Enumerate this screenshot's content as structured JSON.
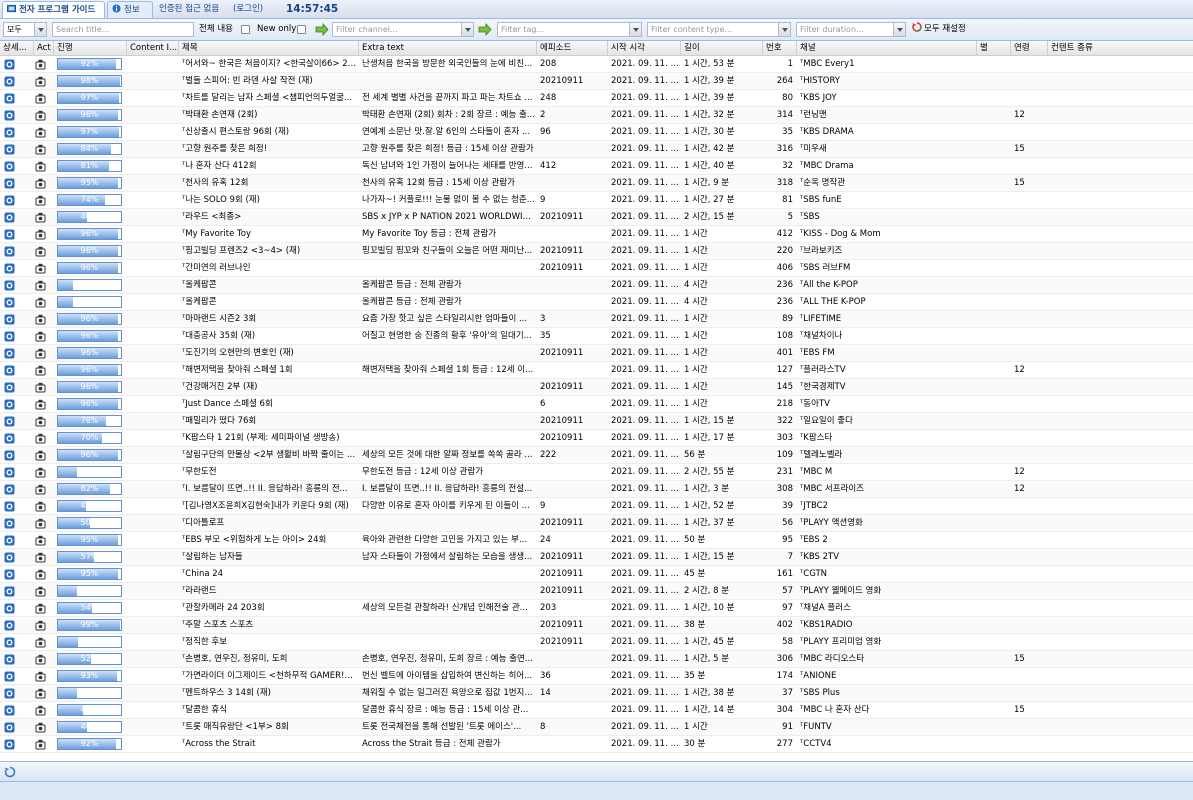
{
  "tabs": {
    "guide": "전자 프로그램 가이드",
    "info": "정보",
    "access": "인증된 접근 없음",
    "login": "(로그인)",
    "clock": "14:57:45"
  },
  "toolbar": {
    "scope_select": "모두",
    "search_placeholder": "Search title...",
    "full_content_label": "전체 내용",
    "new_only_label": "New only",
    "channel_placeholder": "Filter channel...",
    "tag_placeholder": "Filter tag...",
    "content_type_placeholder": "Filter content type...",
    "duration_placeholder": "Filter duration...",
    "reset_label": "모두 재설정"
  },
  "columns": {
    "details": "상세...",
    "actions": "Act",
    "progress": "진행",
    "content_icon": "Content I...",
    "title": "제목",
    "extra": "Extra text",
    "episode": "에피소드",
    "start": "시작 시각",
    "length": "길이",
    "number": "번호",
    "channel": "채널",
    "star": "별",
    "age": "연령",
    "content_type": "컨텐트 종류"
  },
  "rows": [
    {
      "p": 92,
      "pt": "92%",
      "t": "ᵀ어서와~ 한국은 처음이지? <한국살이66> 20...",
      "e": "난생처음 한국을 방문한 외국인들의 눈에 비친...",
      "ep": "208",
      "s": "2021. 09. 11. (...",
      "l": "1 시간, 53 분",
      "n": "1",
      "ch": "ᵀMBC Every1",
      "a": ""
    },
    {
      "p": 98,
      "pt": "98%",
      "t": "ᵀ벌들 스피어: 빈 라덴 사살 작전 (재)",
      "e": "",
      "ep": "20210911",
      "s": "2021. 09. 11. (...",
      "l": "1 시간, 39 분",
      "n": "264",
      "ch": "ᵀHISTORY",
      "a": ""
    },
    {
      "p": 97,
      "pt": "97%",
      "t": "ᵀ차트를 달리는 남자 스페셜 <챔피언의두얼굴...",
      "e": "전 세계 별별 사건을 끝까지 파고 파는 차트쇼 ...",
      "ep": "248",
      "s": "2021. 09. 11. (...",
      "l": "1 시간, 39 분",
      "n": "80",
      "ch": "ᵀKBS JOY",
      "a": ""
    },
    {
      "p": 96,
      "pt": "96%",
      "t": "ᵀ박태환 손연재 (2회)",
      "e": "박태환 손연재 (2회) 회차 : 2회 장르 : 예능 출...",
      "ep": "2",
      "s": "2021. 09. 11. (...",
      "l": "1 시간, 32 분",
      "n": "314",
      "ch": "ᵀ런닝맨",
      "a": "12"
    },
    {
      "p": 97,
      "pt": "97%",
      "t": "ᵀ신상출시 편스토랑 96회 (재)",
      "e": "연예계 소문난 맛.잘.알 6인의 스타들이 혼자 ...",
      "ep": "96",
      "s": "2021. 09. 11. (...",
      "l": "1 시간, 30 분",
      "n": "35",
      "ch": "ᵀKBS DRAMA",
      "a": ""
    },
    {
      "p": 84,
      "pt": "84%",
      "t": "ᵀ고향 원주를 찾은 희정!",
      "e": "고향 원주를 찾은 희정! 등급 : 15세 이상 관람가",
      "ep": "",
      "s": "2021. 09. 11. (...",
      "l": "1 시간, 42 분",
      "n": "316",
      "ch": "ᵀ미우새",
      "a": "15"
    },
    {
      "p": 81,
      "pt": "81%",
      "t": "ᵀ나 혼자 산다 412회",
      "e": "독신 남녀와 1인 가정이 늘어나는 세태를 반영...",
      "ep": "412",
      "s": "2021. 09. 11. (...",
      "l": "1 시간, 40 분",
      "n": "32",
      "ch": "ᵀMBC Drama",
      "a": ""
    },
    {
      "p": 95,
      "pt": "95%",
      "t": "ᵀ천사의 유혹 12회",
      "e": "천사의 유혹 12회 등급 : 15세 이상 관람가",
      "ep": "",
      "s": "2021. 09. 11. (...",
      "l": "1 시간, 9 분",
      "n": "318",
      "ch": "ᵀ순옥 명작관",
      "a": "15"
    },
    {
      "p": 74,
      "pt": "74%",
      "t": "ᵀ나는 SOLO 9회 (재)",
      "e": "나가자~! 커플로!!! 눈물 없이 볼 수 없는 청춘...",
      "ep": "9",
      "s": "2021. 09. 11. (...",
      "l": "1 시간, 27 분",
      "n": "81",
      "ch": "ᵀSBS funE",
      "a": ""
    },
    {
      "p": 46,
      "pt": "46%",
      "t": "ᵀ라우드 <최종>",
      "e": "SBS x JYP x P NATION 2021 WORLDWID...",
      "ep": "20210911",
      "s": "2021. 09. 11. (...",
      "l": "2 시간, 15 분",
      "n": "5",
      "ch": "ᵀSBS",
      "a": ""
    },
    {
      "p": 96,
      "pt": "96%",
      "t": "ᵀMy Favorite Toy",
      "e": "My Favorite Toy 등급 : 전체 관람가",
      "ep": "",
      "s": "2021. 09. 11. (...",
      "l": "1 시간",
      "n": "412",
      "ch": "ᵀKISS - Dog & Mom",
      "a": ""
    },
    {
      "p": 96,
      "pt": "96%",
      "t": "ᵀ핑고빌딩 프렌즈2 <3~4> (재)",
      "e": "핑꼬빌딩 핑꼬와 친구들이 오늘은 어떤 재미난...",
      "ep": "20210911",
      "s": "2021. 09. 11. (...",
      "l": "1 시간",
      "n": "220",
      "ch": "ᵀ브라보키즈",
      "a": ""
    },
    {
      "p": 96,
      "pt": "96%",
      "t": "ᵀ간미연의 러브나인",
      "e": "",
      "ep": "20210911",
      "s": "2021. 09. 11. (...",
      "l": "1 시간",
      "n": "406",
      "ch": "ᵀSBS 러브FM",
      "a": ""
    },
    {
      "p": 24,
      "pt": "24%",
      "t": "ᵀ올케팝콘",
      "e": "올케팝콘 등급 : 전체 관람가",
      "ep": "",
      "s": "2021. 09. 11. (...",
      "l": "4 시간",
      "n": "236",
      "ch": "ᵀAll the K-POP",
      "a": ""
    },
    {
      "p": 24,
      "pt": "24%",
      "t": "ᵀ올케팝콘",
      "e": "올케팝콘 등급 : 전체 관람가",
      "ep": "",
      "s": "2021. 09. 11. (...",
      "l": "4 시간",
      "n": "236",
      "ch": "ᵀALL THE K-POP",
      "a": ""
    },
    {
      "p": 96,
      "pt": "96%",
      "t": "ᵀ마마랜드 시즌2 3회",
      "e": "요즘 가장 핫고 싶은 스타일리시한 엄마들이 ...",
      "ep": "3",
      "s": "2021. 09. 11. (...",
      "l": "1 시간",
      "n": "89",
      "ch": "ᵀLIFETIME",
      "a": ""
    },
    {
      "p": 96,
      "pt": "96%",
      "t": "ᵀ대충공사 35회 (재)",
      "e": "어질고 현명한 숭 진종의 황후 '유아'의 일대기...",
      "ep": "35",
      "s": "2021. 09. 11. (...",
      "l": "1 시간",
      "n": "108",
      "ch": "ᵀ채널차이나",
      "a": ""
    },
    {
      "p": 96,
      "pt": "96%",
      "t": "ᵀ도진기의 오현만의 변호인 (재)",
      "e": "",
      "ep": "20210911",
      "s": "2021. 09. 11. (...",
      "l": "1 시간",
      "n": "401",
      "ch": "ᵀEBS FM",
      "a": ""
    },
    {
      "p": 96,
      "pt": "96%",
      "t": "ᵀ해변저택을 찾아줘 스페셜 1회",
      "e": "해변저택을 찾아줘 스페셜 1회 등급 : 12세 이...",
      "ep": "",
      "s": "2021. 09. 11. (...",
      "l": "1 시간",
      "n": "127",
      "ch": "ᵀ플러라스TV",
      "a": "12"
    },
    {
      "p": 96,
      "pt": "96%",
      "t": "ᵀ건강매거진 2부 (재)",
      "e": "",
      "ep": "20210911",
      "s": "2021. 09. 11. (...",
      "l": "1 시간",
      "n": "145",
      "ch": "ᵀ한국경제TV",
      "a": ""
    },
    {
      "p": 96,
      "pt": "96%",
      "t": "ᵀJust Dance 스페셜 6회",
      "e": "",
      "ep": "6",
      "s": "2021. 09. 11. (...",
      "l": "1 시간",
      "n": "218",
      "ch": "ᵀ동아TV",
      "a": ""
    },
    {
      "p": 76,
      "pt": "76%",
      "t": "ᵀ패밀리가 떴다 76회",
      "e": "",
      "ep": "20210911",
      "s": "2021. 09. 11. (...",
      "l": "1 시간, 15 분",
      "n": "322",
      "ch": "ᵀ일요일이 좋다",
      "a": ""
    },
    {
      "p": 70,
      "pt": "70%",
      "t": "ᵀK팝스타 1 21회 (부제: 세미파이널 생방송)",
      "e": "",
      "ep": "20210911",
      "s": "2021. 09. 11. (...",
      "l": "1 시간, 17 분",
      "n": "303",
      "ch": "ᵀK팝스타",
      "a": ""
    },
    {
      "p": 96,
      "pt": "96%",
      "t": "ᵀ살림구단의 만물상 <2부 생활비 바짝 줄이는 ...",
      "e": "세상의 모든 것에 대한 알짜 정보를 쏙쏙 골라 ...",
      "ep": "222",
      "s": "2021. 09. 11. (...",
      "l": "56 분",
      "n": "109",
      "ch": "ᵀ텔레노벨라",
      "a": ""
    },
    {
      "p": 30,
      "pt": "30%",
      "t": "ᵀ무한도전",
      "e": "무한도전 등급 : 12세 이상 관람가",
      "ep": "",
      "s": "2021. 09. 11. (...",
      "l": "2 시간, 55 분",
      "n": "231",
      "ch": "ᵀMBC M",
      "a": "12"
    },
    {
      "p": 82,
      "pt": "82%",
      "t": "ᵀI. 보름달이 뜨면..!! II. 응답하라! 흥릉의 전...",
      "e": "I. 보름달이 뜨면..!! II. 응답하라! 흥릉의 전설...",
      "ep": "",
      "s": "2021. 09. 11. (...",
      "l": "1 시간, 3 분",
      "n": "308",
      "ch": "ᵀMBC 서프라이즈",
      "a": "12"
    },
    {
      "p": 44,
      "pt": "44%",
      "t": "ᵀ[김나영X조윤희X김현숙]내가 키운다 9회 (재)",
      "e": "다양한 이유로 혼자 아이를 키우게 된 이들이 ...",
      "ep": "9",
      "s": "2021. 09. 11. (...",
      "l": "1 시간, 52 분",
      "n": "39",
      "ch": "ᵀJTBC2",
      "a": ""
    },
    {
      "p": 50,
      "pt": "50%",
      "t": "ᵀ디아틀로프",
      "e": "",
      "ep": "20210911",
      "s": "2021. 09. 11. (...",
      "l": "1 시간, 37 분",
      "n": "56",
      "ch": "ᵀPLAYY 액션영화",
      "a": ""
    },
    {
      "p": 95,
      "pt": "95%",
      "t": "ᵀEBS 부모 <위험하게 노는 아이> 24회",
      "e": "육아와 관련한 다양한 고민을 가지고 있는 부...",
      "ep": "24",
      "s": "2021. 09. 11. (...",
      "l": "50 분",
      "n": "95",
      "ch": "ᵀEBS 2",
      "a": ""
    },
    {
      "p": 57,
      "pt": "57%",
      "t": "ᵀ살림하는 남자들",
      "e": "남자 스타들이 가정에서 살림하는 모습을 생생...",
      "ep": "20210911",
      "s": "2021. 09. 11. (...",
      "l": "1 시간, 15 분",
      "n": "7",
      "ch": "ᵀKBS 2TV",
      "a": ""
    },
    {
      "p": 95,
      "pt": "95%",
      "t": "ᵀChina 24",
      "e": "",
      "ep": "20210911",
      "s": "2021. 09. 11. (...",
      "l": "45 분",
      "n": "161",
      "ch": "ᵀCGTN",
      "a": ""
    },
    {
      "p": 30,
      "pt": "30%",
      "t": "ᵀ라라랜드",
      "e": "",
      "ep": "20210911",
      "s": "2021. 09. 11. (...",
      "l": "2 시간, 8 분",
      "n": "57",
      "ch": "ᵀPLAYY 웰메이드 영화",
      "a": ""
    },
    {
      "p": 54,
      "pt": "54%",
      "t": "ᵀ관찰카메라 24 203회",
      "e": "세상의 모든걸 관찰하라! 신개념 인해전술 관...",
      "ep": "203",
      "s": "2021. 09. 11. (...",
      "l": "1 시간, 10 분",
      "n": "97",
      "ch": "ᵀ채널A 플러스",
      "a": ""
    },
    {
      "p": 99,
      "pt": "99%",
      "t": "ᵀ주말 스포츠 스포츠",
      "e": "",
      "ep": "20210911",
      "s": "2021. 09. 11. (...",
      "l": "38 분",
      "n": "402",
      "ch": "ᵀKBS1RADIO",
      "a": ""
    },
    {
      "p": 32,
      "pt": "32%",
      "t": "ᵀ정직한 후보",
      "e": "",
      "ep": "20210911",
      "s": "2021. 09. 11. (...",
      "l": "1 시간, 45 분",
      "n": "58",
      "ch": "ᵀPLAYY 프리미엄 영화",
      "a": ""
    },
    {
      "p": 52,
      "pt": "52%",
      "t": "ᵀ손병호, 연우진, 정유미, 도희",
      "e": "손병호, 연우진, 정유미, 도희 장르 : 예능 출연...",
      "ep": "",
      "s": "2021. 09. 11. (...",
      "l": "1 시간, 5 분",
      "n": "306",
      "ch": "ᵀMBC 라디오스타",
      "a": "15"
    },
    {
      "p": 93,
      "pt": "93%",
      "t": "ᵀ가면라이더 이그제이드 <천하무적 GAMER!>...",
      "e": "번신 벨트에 아이템을 삽입하여 변신하는 히어...",
      "ep": "36",
      "s": "2021. 09. 11. (...",
      "l": "35 분",
      "n": "174",
      "ch": "ᵀANIONE",
      "a": ""
    },
    {
      "p": 30,
      "pt": "30%",
      "t": "ᵀ펜트하우스 3 14회 (재)",
      "e": "채워질 수 없는 일그러진 욕망으로 집값 1번지...",
      "ep": "14",
      "s": "2021. 09. 11. (...",
      "l": "1 시간, 38 분",
      "n": "37",
      "ch": "ᵀSBS Plus",
      "a": ""
    },
    {
      "p": 40,
      "pt": "40%",
      "t": "ᵀ달콤한 휴식",
      "e": "달콤한 휴식 장르 : 예능 등급 : 15세 이상 관...",
      "ep": "",
      "s": "2021. 09. 11. (...",
      "l": "1 시간, 14 분",
      "n": "304",
      "ch": "ᵀMBC 나 혼자 산다",
      "a": "15"
    },
    {
      "p": 46,
      "pt": "46%",
      "t": "ᵀ트롯 매직유랑단 <1부> 8회",
      "e": "트롯 전국체전을 통해 선발된 '트롯 에이스'...",
      "ep": "8",
      "s": "2021. 09. 11. (...",
      "l": "1 시간",
      "n": "91",
      "ch": "ᵀFUNTV",
      "a": ""
    },
    {
      "p": 92,
      "pt": "92%",
      "t": "ᵀAcross the Strait",
      "e": "Across the Strait 등급 : 전체 관람가",
      "ep": "",
      "s": "2021. 09. 11. (...",
      "l": "30 분",
      "n": "277",
      "ch": "ᵀCCTV4",
      "a": ""
    }
  ]
}
